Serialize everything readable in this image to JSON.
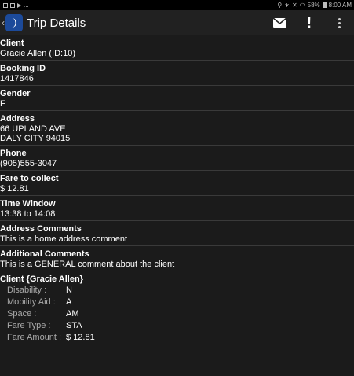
{
  "status_bar": {
    "left_text": "...",
    "battery": "58%",
    "time": "8:00 AM"
  },
  "app_bar": {
    "back": "‹",
    "title": "Trip Details",
    "actions": [
      "mail-icon",
      "alert-icon",
      "overflow-menu-icon"
    ]
  },
  "fields": [
    {
      "label": "Client",
      "lines": [
        "Gracie Allen (ID:10)"
      ]
    },
    {
      "label": "Booking ID",
      "lines": [
        "1417846"
      ]
    },
    {
      "label": "Gender",
      "lines": [
        "F"
      ]
    },
    {
      "label": "Address",
      "lines": [
        "66 UPLAND AVE",
        "DALY CITY 94015"
      ]
    },
    {
      "label": "Phone",
      "lines": [
        "(905)555-3047"
      ]
    },
    {
      "label": "Fare to collect",
      "lines": [
        "$ 12.81"
      ]
    },
    {
      "label": "Time Window",
      "lines": [
        "13:38 to 14:08"
      ]
    },
    {
      "label": "Address Comments",
      "lines": [
        "This is a home address comment"
      ]
    },
    {
      "label": "Additional Comments",
      "lines": [
        "This is a GENERAL comment about the client"
      ]
    }
  ],
  "client_details": {
    "heading": "Client {Gracie Allen}",
    "rows": [
      {
        "label": "Disability :",
        "value": "N"
      },
      {
        "label": "Mobility Aid :",
        "value": "A"
      },
      {
        "label": "Space :",
        "value": "AM"
      },
      {
        "label": "Fare Type :",
        "value": "STA"
      },
      {
        "label": "Fare Amount :",
        "value": "$ 12.81"
      }
    ]
  }
}
